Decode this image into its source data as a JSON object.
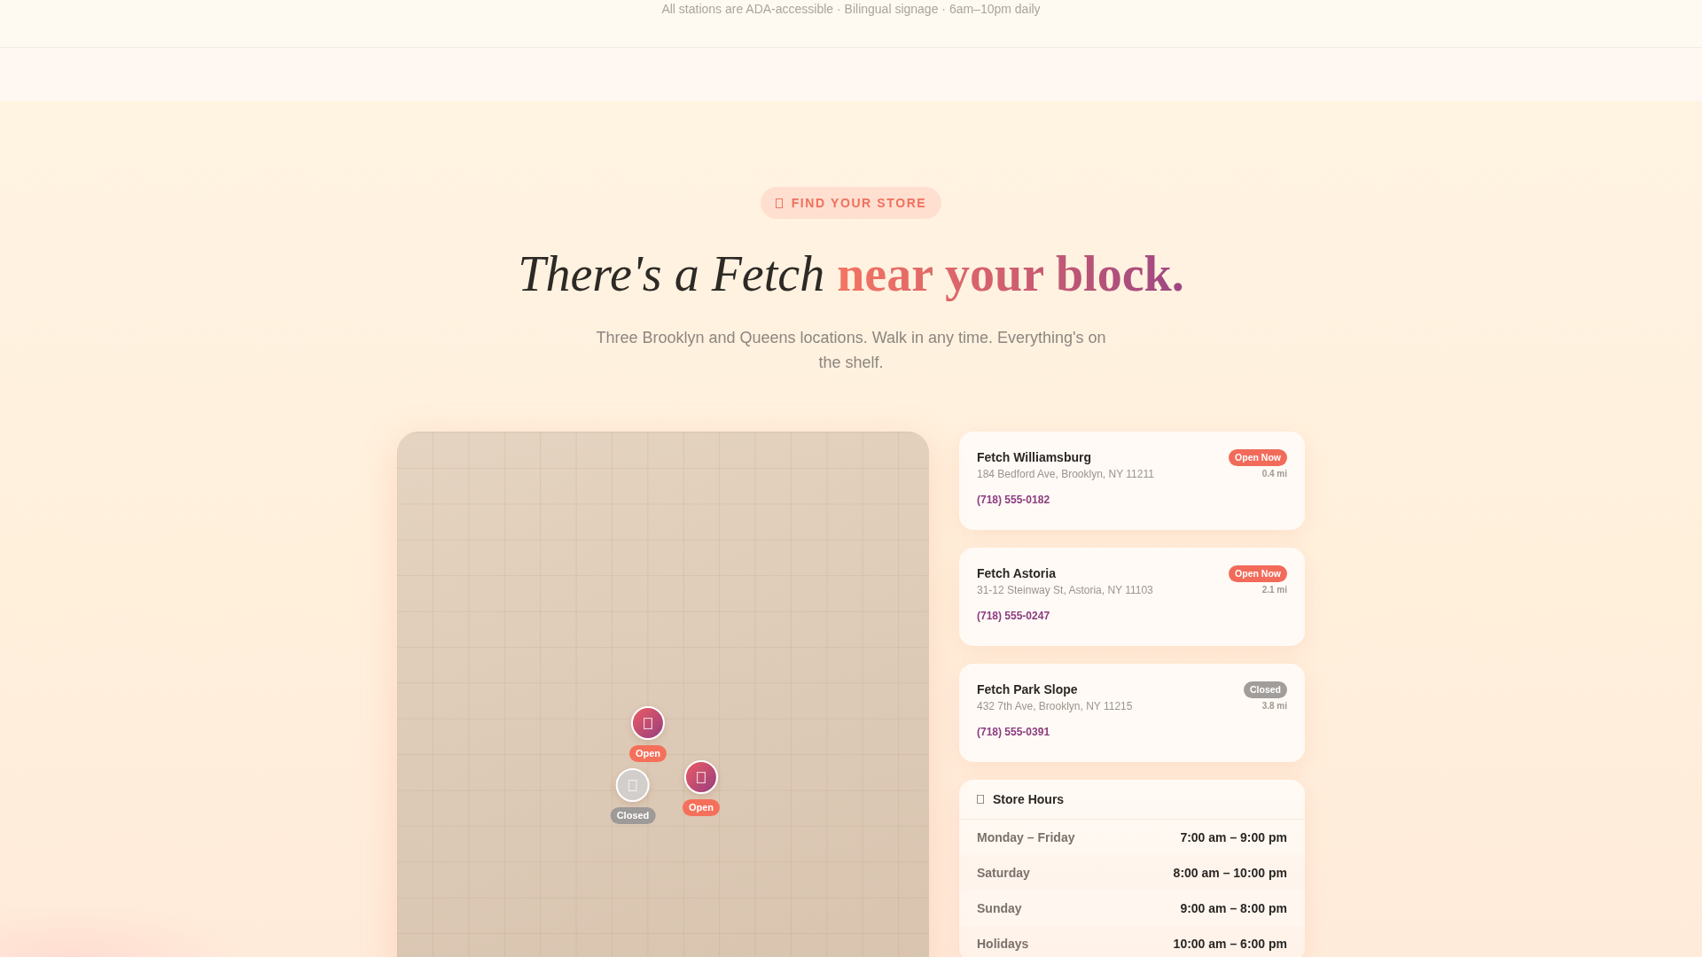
{
  "notice": {
    "text": "All stations are ADA-accessible · Bilingual signage · 6am–10pm daily"
  },
  "hero": {
    "eyebrow": "FIND YOUR STORE",
    "title": "*There's a Fetch* **near your block.**",
    "subtitle": "Three Brooklyn and Queens locations. Walk in any time. Everything's on the shelf."
  },
  "map": {
    "markers": [
      {
        "label": "Open",
        "open": true
      },
      {
        "label": "Open",
        "open": true
      },
      {
        "label": "Closed",
        "open": false
      }
    ]
  },
  "stores": [
    {
      "name": "Fetch Williamsburg",
      "address": "184 Bedford Ave, Brooklyn, NY 11211",
      "status": "Open Now",
      "open": true,
      "distance": "0.4 mi",
      "phone": "(718) 555-0182"
    },
    {
      "name": "Fetch Astoria",
      "address": "31-12 Steinway St, Astoria, NY 11103",
      "status": "Open Now",
      "open": true,
      "distance": "2.1 mi",
      "phone": "(718) 555-0247"
    },
    {
      "name": "Fetch Park Slope",
      "address": "432 7th Ave, Brooklyn, NY 11215",
      "status": "Closed",
      "open": false,
      "distance": "3.8 mi",
      "phone": "(718) 555-0391"
    }
  ],
  "hours": {
    "title": "Store Hours",
    "rows": [
      {
        "days": "Monday – Friday",
        "time": "7:00 am – 9:00 pm"
      },
      {
        "days": "Saturday",
        "time": "8:00 am – 10:00 pm"
      },
      {
        "days": "Sunday",
        "time": "9:00 am – 8:00 pm"
      },
      {
        "days": "Holidays",
        "time": "10:00 am – 6:00 pm"
      }
    ]
  }
}
